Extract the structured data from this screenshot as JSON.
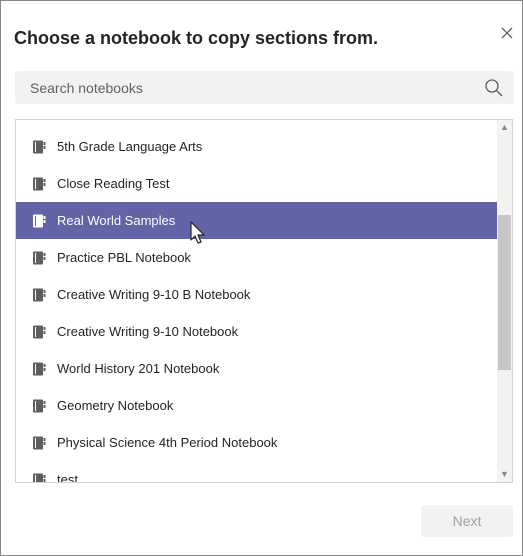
{
  "dialog": {
    "title": "Choose a notebook to copy sections from.",
    "close_icon": "close-icon"
  },
  "search": {
    "placeholder": "Search notebooks",
    "value": "",
    "icon": "search-icon"
  },
  "notebooks": {
    "icon": "notebook-icon",
    "selected_index": 2,
    "items": [
      {
        "label": "5th Grade Language Arts"
      },
      {
        "label": "Close Reading Test"
      },
      {
        "label": "Real World Samples"
      },
      {
        "label": "Practice PBL Notebook"
      },
      {
        "label": "Creative Writing 9-10 B Notebook"
      },
      {
        "label": "Creative Writing 9-10 Notebook"
      },
      {
        "label": "World History 201 Notebook"
      },
      {
        "label": "Geometry Notebook"
      },
      {
        "label": "Physical Science 4th Period Notebook"
      },
      {
        "label": "test"
      }
    ]
  },
  "footer": {
    "next_label": "Next",
    "next_enabled": false
  },
  "colors": {
    "accent": "#6264a7",
    "selected_text": "#ffffff",
    "disabled_text": "#a19f9d"
  }
}
